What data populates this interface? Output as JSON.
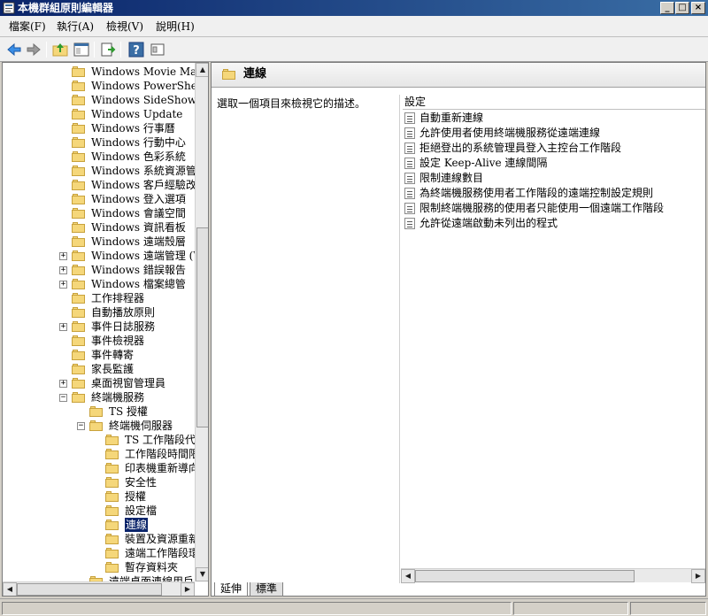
{
  "window": {
    "title": "本機群組原則編輯器"
  },
  "menu": [
    "檔案(F)",
    "執行(A)",
    "檢視(V)",
    "說明(H)"
  ],
  "tree": {
    "items": [
      {
        "label": "Windows Movie Maker",
        "level": 3,
        "expander": ""
      },
      {
        "label": "Windows PowerShell",
        "level": 3,
        "expander": ""
      },
      {
        "label": "Windows SideShow",
        "level": 3,
        "expander": ""
      },
      {
        "label": "Windows Update",
        "level": 3,
        "expander": ""
      },
      {
        "label": "Windows 行事曆",
        "level": 3,
        "expander": ""
      },
      {
        "label": "Windows 行動中心",
        "level": 3,
        "expander": ""
      },
      {
        "label": "Windows 色彩系統",
        "level": 3,
        "expander": ""
      },
      {
        "label": "Windows 系統資源管理",
        "level": 3,
        "expander": ""
      },
      {
        "label": "Windows 客戶經驗改進",
        "level": 3,
        "expander": ""
      },
      {
        "label": "Windows 登入選項",
        "level": 3,
        "expander": ""
      },
      {
        "label": "Windows 會議空間",
        "level": 3,
        "expander": ""
      },
      {
        "label": "Windows 資訊看板",
        "level": 3,
        "expander": ""
      },
      {
        "label": "Windows 遠端殼層",
        "level": 3,
        "expander": ""
      },
      {
        "label": "Windows 遠端管理 (W:",
        "level": 3,
        "expander": "+"
      },
      {
        "label": "Windows 錯誤報告",
        "level": 3,
        "expander": "+"
      },
      {
        "label": "Windows 檔案總管",
        "level": 3,
        "expander": "+"
      },
      {
        "label": "工作排程器",
        "level": 3,
        "expander": ""
      },
      {
        "label": "自動播放原則",
        "level": 3,
        "expander": ""
      },
      {
        "label": "事件日誌服務",
        "level": 3,
        "expander": "+"
      },
      {
        "label": "事件檢視器",
        "level": 3,
        "expander": ""
      },
      {
        "label": "事件轉寄",
        "level": 3,
        "expander": ""
      },
      {
        "label": "家長監護",
        "level": 3,
        "expander": ""
      },
      {
        "label": "桌面視窗管理員",
        "level": 3,
        "expander": "+"
      },
      {
        "label": "終端機服務",
        "level": 3,
        "expander": "-"
      },
      {
        "label": "TS 授權",
        "level": 4,
        "expander": ""
      },
      {
        "label": "終端機伺服器",
        "level": 4,
        "expander": "-"
      },
      {
        "label": "TS 工作階段代",
        "level": 5,
        "expander": ""
      },
      {
        "label": "工作階段時間限",
        "level": 5,
        "expander": ""
      },
      {
        "label": "印表機重新導向",
        "level": 5,
        "expander": ""
      },
      {
        "label": "安全性",
        "level": 5,
        "expander": ""
      },
      {
        "label": "授權",
        "level": 5,
        "expander": ""
      },
      {
        "label": "設定檔",
        "level": 5,
        "expander": ""
      },
      {
        "label": "連線",
        "level": 5,
        "expander": "",
        "selected": true
      },
      {
        "label": "裝置及資源重新",
        "level": 5,
        "expander": ""
      },
      {
        "label": "遠端工作階段環",
        "level": 5,
        "expander": ""
      },
      {
        "label": "暫存資料夾",
        "level": 5,
        "expander": ""
      },
      {
        "label": "遠端桌面連線用戶",
        "level": 4,
        "expander": ""
      }
    ]
  },
  "right": {
    "title": "連線",
    "description": "選取一個項目來檢視它的描述。",
    "column_header": "設定",
    "settings": [
      "自動重新連線",
      "允許使用者使用終端機服務從遠端連線",
      "拒絕登出的系統管理員登入主控台工作階段",
      "設定 Keep-Alive 連線間隔",
      "限制連線數目",
      "為終端機服務使用者工作階段的遠端控制設定規則",
      "限制終端機服務的使用者只能使用一個遠端工作階段",
      "允許從遠端啟動未列出的程式"
    ]
  },
  "tabs": [
    "延伸",
    "標準"
  ],
  "colors": {
    "titlebar": "#0a246a",
    "selection": "#0a246a",
    "folder": "#f5d77a"
  }
}
